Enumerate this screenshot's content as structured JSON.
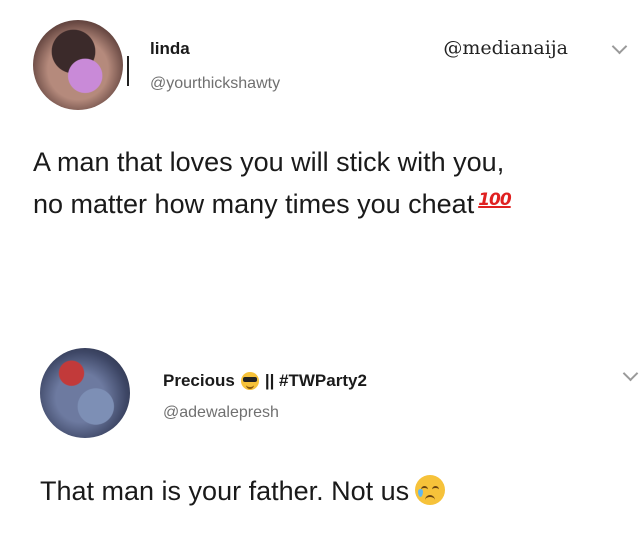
{
  "tweets": [
    {
      "name": "linda",
      "handle": "@yourthickshawty",
      "watermark": "@medianaija",
      "text": "A man that loves you will stick with you,",
      "text_line2": "no matter how many times you cheat",
      "emoji": "100"
    },
    {
      "name": "Precious",
      "name_suffix": "|| #TWParty2",
      "handle": "@adewalepresh",
      "text": "That man is your father. Not us"
    }
  ],
  "icons": {
    "tweet1_avatar": "profile-photo",
    "tweet1_menu": "chevron-down-icon",
    "tweet1_emoji": "hundred-points-emoji",
    "tweet2_avatar": "profile-photo",
    "tweet2_name_emoji": "sunglasses-face-emoji",
    "tweet2_menu": "chevron-down-icon",
    "tweet2_emoji": "sad-but-relieved-face-emoji"
  }
}
